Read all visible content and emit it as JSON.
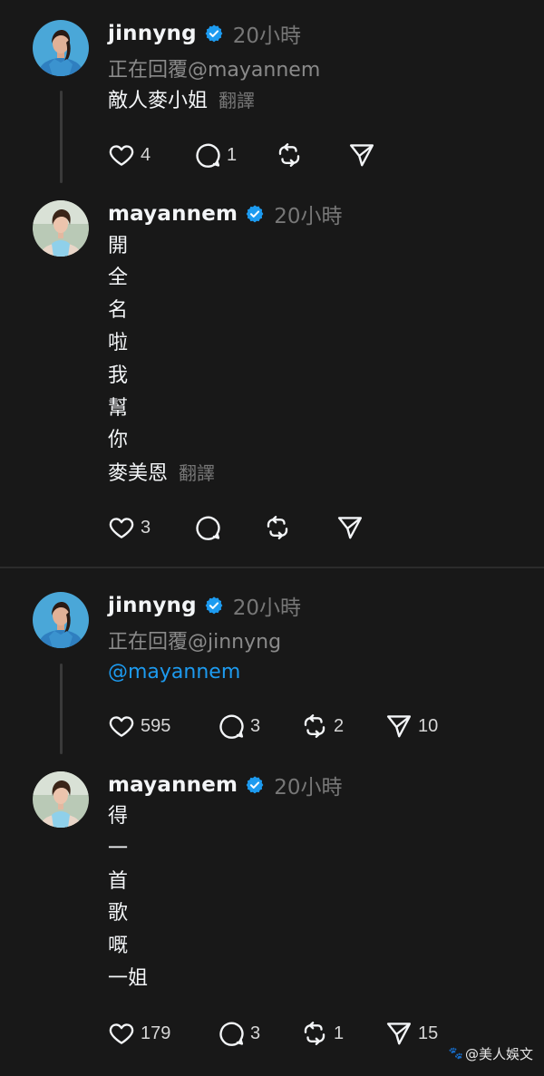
{
  "colors": {
    "accent": "#1d9bf0",
    "background": "#181818",
    "text": "#f3f5f7",
    "muted": "#777777"
  },
  "posts": [
    {
      "username": "jinnyng",
      "time": "20小時",
      "replying": "正在回覆@mayannem",
      "lines": [
        "敵人麥小姐"
      ],
      "translate": "翻譯",
      "likes": "4",
      "replies": "1",
      "reposts": "",
      "shares": ""
    },
    {
      "username": "mayannem",
      "time": "20小時",
      "lines": [
        "開",
        "全",
        "名",
        "啦",
        "我",
        "幫",
        "你",
        "麥美恩"
      ],
      "translate": "翻譯",
      "likes": "3",
      "replies": "",
      "reposts": "",
      "shares": ""
    },
    {
      "username": "jinnyng",
      "time": "20小時",
      "replying": "正在回覆@jinnyng",
      "mention": "@mayannem",
      "likes": "595",
      "replies": "3",
      "reposts": "2",
      "shares": "10"
    },
    {
      "username": "mayannem",
      "time": "20小時",
      "lines": [
        "得",
        "一",
        "首",
        "歌",
        "嘅",
        "一姐"
      ],
      "likes": "179",
      "replies": "3",
      "reposts": "1",
      "shares": "15"
    }
  ],
  "watermark": "@美人娛文",
  "icons": {
    "like": "heart-icon",
    "reply": "comment-icon",
    "repost": "repost-icon",
    "share": "send-icon",
    "verified": "verified-badge-icon"
  }
}
